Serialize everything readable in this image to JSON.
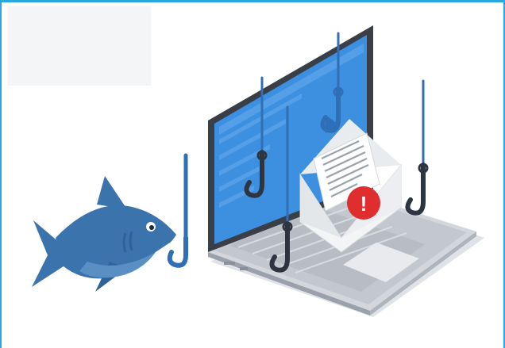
{
  "illustration": {
    "subject": "phishing-email-laptop-with-hooks-and-shark",
    "alert_symbol": "!",
    "colors": {
      "frame": "#29a8e0",
      "screen_blue": "#3d8fe0",
      "hook_blue": "#2f6fb5",
      "shark_blue": "#3b74ad",
      "alert_red": "#e02d2d",
      "hook_dark": "#2e3440",
      "laptop_gray": "#c8ccd2"
    },
    "icons": [
      "shark-icon",
      "fish-hook-icon",
      "envelope-icon",
      "alert-icon",
      "laptop-icon"
    ]
  }
}
